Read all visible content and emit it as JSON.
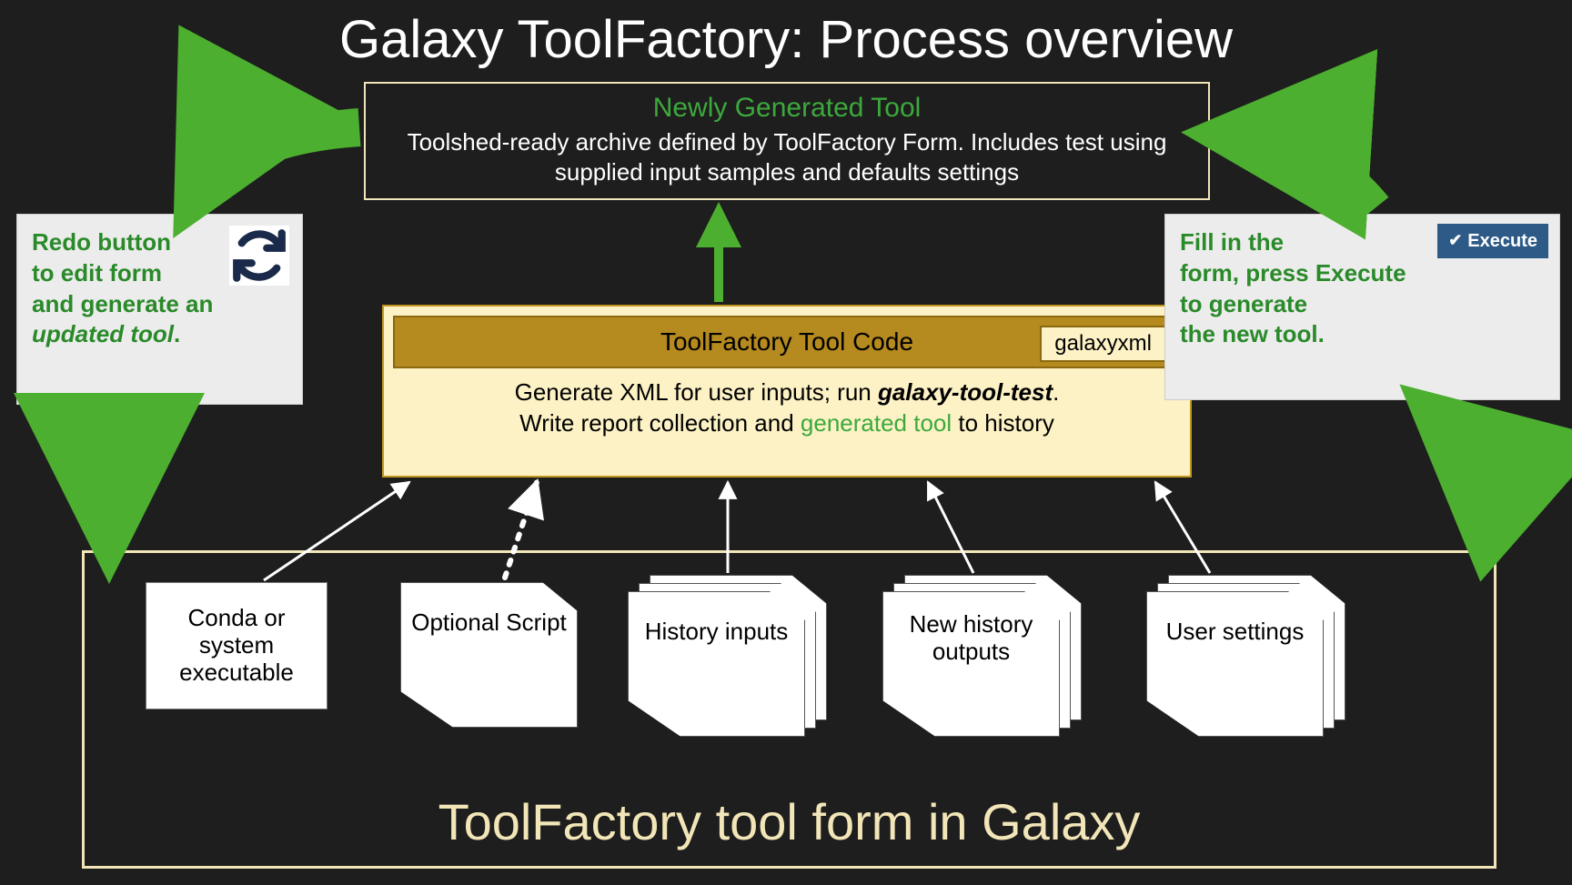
{
  "title": "Galaxy ToolFactory: Process overview",
  "ngt": {
    "title": "Newly Generated Tool",
    "desc": "Toolshed-ready archive defined by ToolFactory Form. Includes test using supplied input samples and defaults settings"
  },
  "toolcode": {
    "header": "ToolFactory Tool Code",
    "chip": "galaxyxml",
    "line1a": "Generate XML for user inputs; run ",
    "line1b": "galaxy-tool-test",
    "line1c": ".",
    "line2a": "Write report collection and ",
    "line2b": "generated tool",
    "line2c": " to history"
  },
  "form": {
    "title": "ToolFactory tool form in Galaxy",
    "cards": {
      "conda": "Conda or system executable",
      "script": "Optional Script",
      "history_inputs": "History inputs",
      "history_outputs": "New history outputs",
      "user_settings": "User settings"
    }
  },
  "left_callout": {
    "l1": "Redo button",
    "l2": "to edit form",
    "l3": "and generate an",
    "l4": "updated tool"
  },
  "right_callout": {
    "l1": "Fill in the",
    "l2": "form, press Execute",
    "l3": "to generate",
    "l4": "the new tool.",
    "exec": "Execute"
  }
}
